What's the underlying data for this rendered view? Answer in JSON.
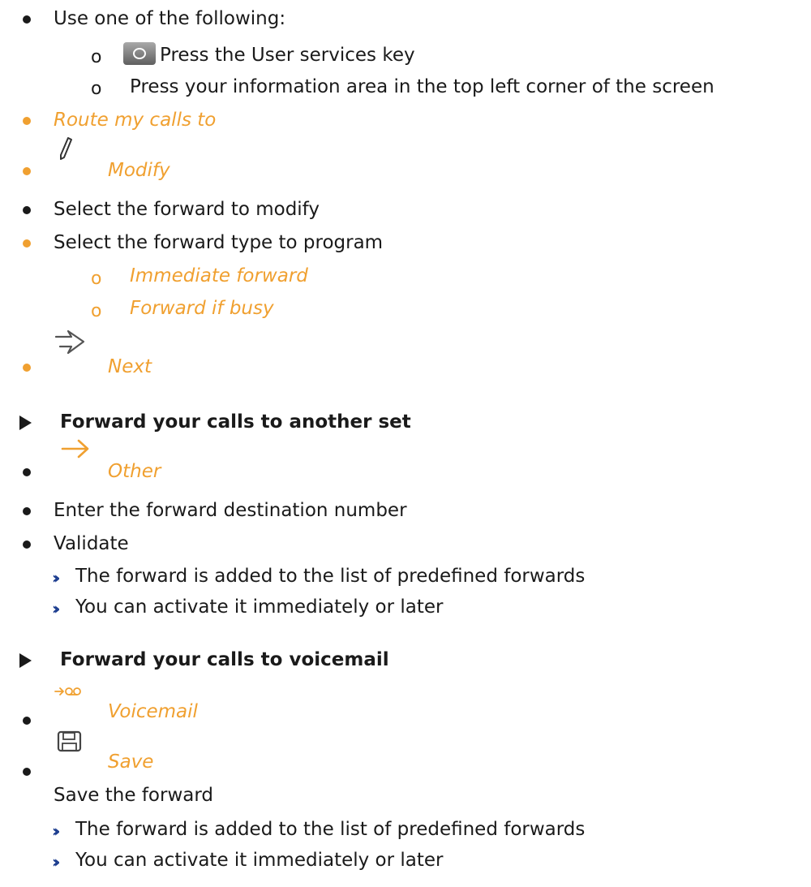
{
  "steps": {
    "use_one": "Use one of the following:",
    "press_user_key": "Press the User services key",
    "press_info_area": "Press your information area in the top left corner of the screen",
    "route_calls": "Route my calls to",
    "modify": "Modify",
    "select_forward": "Select the forward to modify",
    "select_type": "Select the forward type to program",
    "immediate": "Immediate forward",
    "if_busy": "Forward if busy",
    "next": "Next"
  },
  "section_other": {
    "heading": "Forward your calls to another set",
    "other": "Other",
    "enter_number": "Enter the forward destination number",
    "validate": "Validate",
    "result1": "The forward is added to the list of predefined forwards",
    "result2": "You can activate it immediately or later"
  },
  "section_voicemail": {
    "heading": "Forward your calls to voicemail",
    "voicemail": "Voicemail",
    "save": "Save",
    "save_desc": "Save the forward",
    "result1": "The forward is added to the list of predefined forwards",
    "result2": "You can activate it immediately or later"
  },
  "colors": {
    "accent": "#f0a030",
    "text": "#1a1a1a",
    "chevron": "#1c3d8f"
  },
  "icons": [
    "user-services-key-icon",
    "pencil-icon",
    "next-arrow-icon",
    "orange-arrow-icon",
    "voicemail-icon",
    "save-disk-icon"
  ]
}
